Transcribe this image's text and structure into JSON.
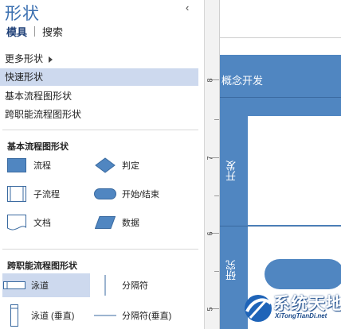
{
  "pane": {
    "title": "形状",
    "tabs": [
      "模具",
      "搜索"
    ],
    "more_shapes": "更多形状",
    "quick_shapes": "快速形状",
    "stencils": [
      "基本流程图形状",
      "跨职能流程图形状"
    ]
  },
  "sections": [
    {
      "title": "基本流程图形状",
      "shapes": [
        {
          "label": "流程",
          "icon": "process-rectangle-icon"
        },
        {
          "label": "判定",
          "icon": "decision-diamond-icon"
        },
        {
          "label": "子流程",
          "icon": "subprocess-icon"
        },
        {
          "label": "开始/结束",
          "icon": "terminator-icon"
        },
        {
          "label": "文档",
          "icon": "document-icon"
        },
        {
          "label": "数据",
          "icon": "data-parallelogram-icon"
        }
      ]
    },
    {
      "title": "跨职能流程图形状",
      "shapes": [
        {
          "label": "泳道",
          "icon": "swimlane-icon"
        },
        {
          "label": "分隔符",
          "icon": "separator-icon"
        },
        {
          "label": "泳道 (垂直)",
          "icon": "swimlane-vertical-icon"
        },
        {
          "label": "分隔符(垂直)",
          "icon": "separator-vertical-icon"
        }
      ]
    }
  ],
  "ruler": {
    "numbers": [
      "8",
      "7",
      "6",
      "5"
    ]
  },
  "canvas": {
    "pool_title": "概念开发",
    "lanes": [
      "开发",
      "研究"
    ],
    "accent": "#5086c1"
  },
  "watermark": {
    "title": "系统天地",
    "url": "XiTongTianDi.net"
  }
}
